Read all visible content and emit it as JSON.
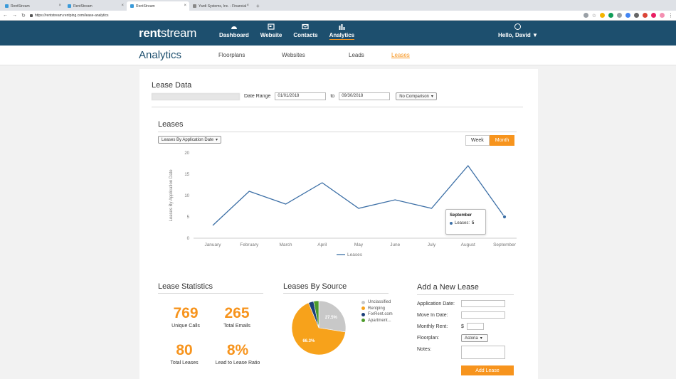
{
  "browser": {
    "tabs": [
      {
        "label": "RentStream"
      },
      {
        "label": "RentStream"
      },
      {
        "label": "RentStream"
      },
      {
        "label": "Yardi Systems, Inc. - Financial"
      }
    ],
    "new_tab": "+",
    "url": "https://rentstream.rentping.com/lease-analytics"
  },
  "header": {
    "logo_bold": "rent",
    "logo_light": "stream",
    "nav": [
      {
        "label": "Dashboard",
        "icon": "dashboard-icon"
      },
      {
        "label": "Website",
        "icon": "website-icon"
      },
      {
        "label": "Contacts",
        "icon": "contacts-icon"
      },
      {
        "label": "Analytics",
        "icon": "analytics-icon"
      }
    ],
    "greeting": "Hello, David"
  },
  "subheader": {
    "title": "Analytics",
    "tabs": [
      "Floorplans",
      "Websites",
      "Leads",
      "Leases"
    ],
    "active_tab": "Leases"
  },
  "lease_data": {
    "title": "Lease Data",
    "date_range_label": "Date Range",
    "start_date": "01/01/2018",
    "to_label": "to",
    "end_date": "09/30/2018",
    "comparison": "No Comparison"
  },
  "leases_chart": {
    "title": "Leases",
    "mode": "Leases By Application Date",
    "toggle": [
      "Week",
      "Month"
    ],
    "active_toggle": "Month"
  },
  "chart_data": {
    "type": "line",
    "categories": [
      "January",
      "February",
      "March",
      "April",
      "May",
      "June",
      "July",
      "August",
      "September"
    ],
    "series": [
      {
        "name": "Leases",
        "values": [
          3,
          11,
          8,
          13,
          7,
          9,
          7,
          17,
          5
        ]
      }
    ],
    "ylabel": "Leases By Application Date",
    "ylim": [
      0,
      20
    ],
    "yticks": [
      0,
      5,
      10,
      15,
      20
    ],
    "legend_position": "bottom",
    "color": "#3c6fa6"
  },
  "tooltip": {
    "title": "September",
    "label": "Leases:",
    "value": "5"
  },
  "stats": {
    "title": "Lease Statistics",
    "items": [
      {
        "value": "769",
        "label": "Unique Calls"
      },
      {
        "value": "265",
        "label": "Total Emails"
      },
      {
        "value": "80",
        "label": "Total Leases"
      },
      {
        "value": "8%",
        "label": "Lead to Lease Ratio"
      }
    ]
  },
  "sources": {
    "title": "Leases By Source",
    "slices": [
      {
        "name": "Unclassified",
        "value": 27.5,
        "label": "27.5%",
        "color": "#c8c8c8"
      },
      {
        "name": "Rentping",
        "value": 66.3,
        "label": "66.3%",
        "color": "#f7a21b"
      },
      {
        "name": "ForRent.com",
        "value": 3.1,
        "label": "",
        "color": "#1b3f7a"
      },
      {
        "name": "Apartment...",
        "value": 3.1,
        "label": "",
        "color": "#4c9a2a"
      }
    ]
  },
  "add_lease": {
    "title": "Add a New Lease",
    "application_date": "Application Date:",
    "move_in_date": "Move In Date:",
    "monthly_rent": "Monthly Rent:",
    "currency": "$",
    "floorplan": "Floorplan:",
    "floorplan_value": "Astoria",
    "notes": "Notes:",
    "button": "Add Lease"
  }
}
